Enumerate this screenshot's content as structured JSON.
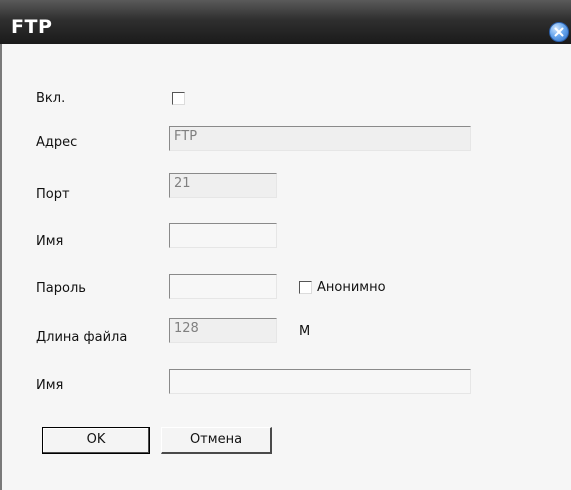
{
  "window": {
    "title": "FTP",
    "close_icon": "close-icon"
  },
  "form": {
    "enable": {
      "label": "Вкл.",
      "checked": false
    },
    "address": {
      "label": "Адрес",
      "value": "FTP"
    },
    "port": {
      "label": "Порт",
      "value": "21"
    },
    "username": {
      "label": "Имя",
      "value": ""
    },
    "password": {
      "label": "Пароль",
      "value": "",
      "anonymous_label": "Анонимно",
      "anonymous_checked": false
    },
    "file_length": {
      "label": "Длина файла",
      "value": "128",
      "unit": "M"
    },
    "dir_name": {
      "label": "Имя",
      "value": ""
    }
  },
  "buttons": {
    "ok_label": "OK",
    "cancel_label": "Отмена"
  },
  "colors": {
    "title_bar": "#2f2f2f",
    "close_button": "#4a8fe0",
    "dialog_bg": "#f6f6f6"
  }
}
